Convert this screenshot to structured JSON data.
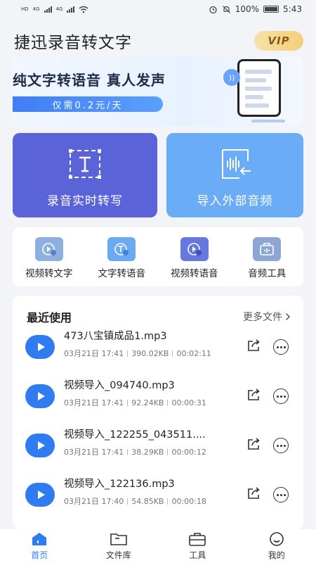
{
  "status": {
    "net_a": "HD",
    "net_b": "HD",
    "signal_a": "4G",
    "signal_b": "4G",
    "battery": "100%",
    "time": "5:43"
  },
  "header": {
    "title": "捷迅录音转文字",
    "vip": "VIP"
  },
  "banner": {
    "title": "纯文字转语音  真人发声",
    "price": "仅需0.2元/天"
  },
  "main_actions": [
    {
      "label": "录音实时转写",
      "icon": "text-frame-icon"
    },
    {
      "label": "导入外部音频",
      "icon": "audio-import-icon"
    }
  ],
  "tools": [
    {
      "label": "视频转文字",
      "icon": "video-to-text-icon"
    },
    {
      "label": "文字转语音",
      "icon": "text-to-speech-icon"
    },
    {
      "label": "视频转语音",
      "icon": "video-to-audio-icon"
    },
    {
      "label": "音频工具",
      "icon": "audio-tools-icon"
    }
  ],
  "recent": {
    "title": "最近使用",
    "more": "更多文件",
    "files": [
      {
        "name": "473八宝镇成品1.mp3",
        "date": "03月21日 17:41",
        "size": "390.02KB",
        "duration": "00:02:11"
      },
      {
        "name": "视频导入_094740.mp3",
        "date": "03月21日 17:41",
        "size": "92.24KB",
        "duration": "00:00:31"
      },
      {
        "name": "视频导入_122255_043511....",
        "date": "03月21日 17:41",
        "size": "38.29KB",
        "duration": "00:00:12"
      },
      {
        "name": "视频导入_122136.mp3",
        "date": "03月21日 17:40",
        "size": "54.85KB",
        "duration": "00:00:18"
      }
    ]
  },
  "tabs": [
    {
      "label": "首页",
      "icon": "home-icon",
      "active": true
    },
    {
      "label": "文件库",
      "icon": "folder-icon",
      "active": false
    },
    {
      "label": "工具",
      "icon": "toolbox-icon",
      "active": false
    },
    {
      "label": "我的",
      "icon": "smiley-icon",
      "active": false
    }
  ],
  "colors": {
    "accent": "#2f7cf0",
    "card_left": "#5a63d8",
    "card_right": "#6aacf5"
  }
}
